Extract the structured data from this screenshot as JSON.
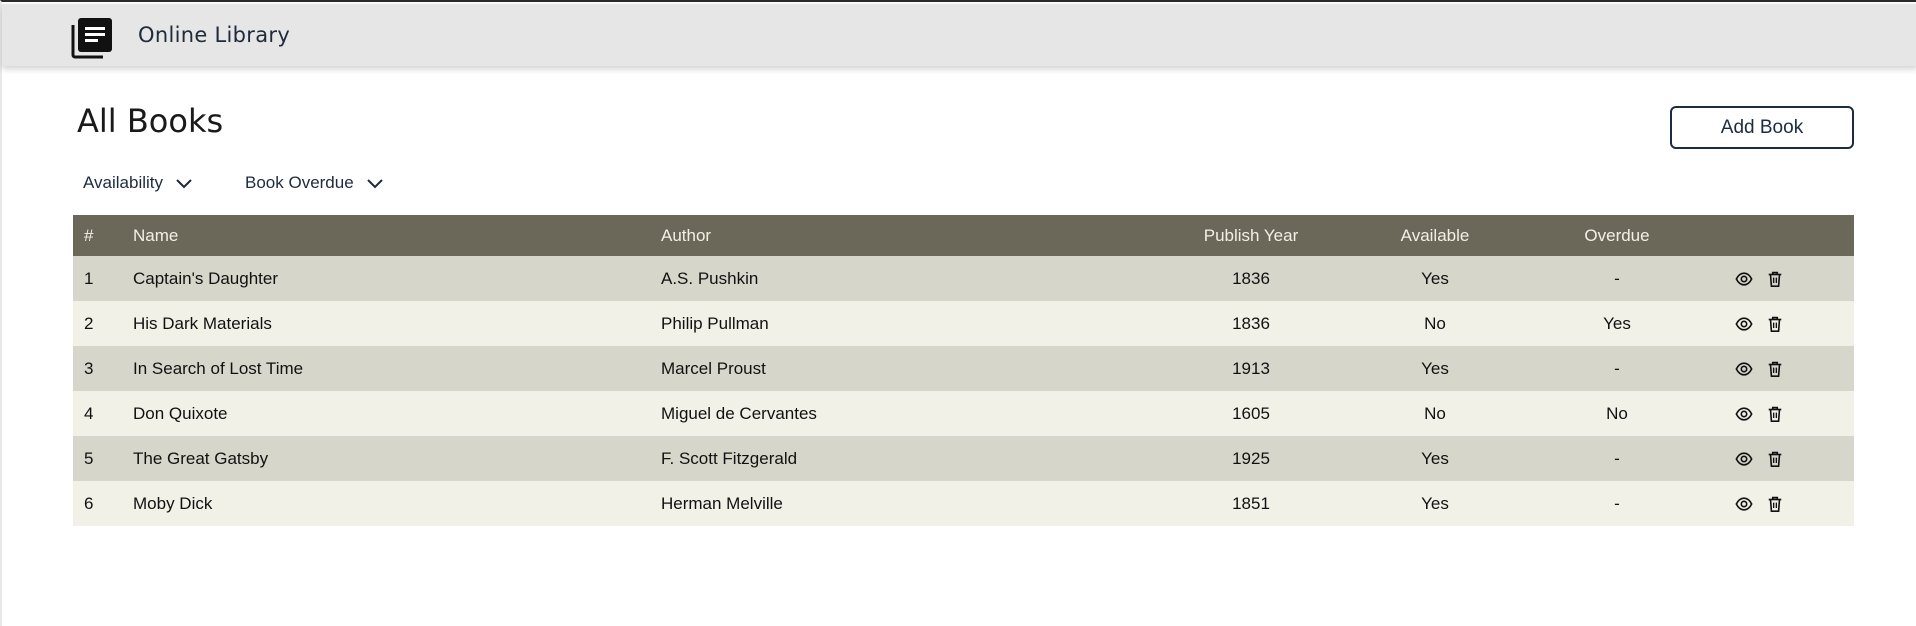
{
  "app": {
    "title": "Online Library",
    "logo_icon": "book-icon"
  },
  "page": {
    "title": "All Books"
  },
  "toolbar": {
    "add_label": "Add Book"
  },
  "filters": [
    {
      "label": "Availability",
      "icon": "chevron-down-icon"
    },
    {
      "label": "Book Overdue",
      "icon": "chevron-down-icon"
    }
  ],
  "table": {
    "columns": [
      "#",
      "Name",
      "Author",
      "Publish Year",
      "Available",
      "Overdue",
      ""
    ],
    "rows": [
      {
        "num": "1",
        "name": "Captain's Daughter",
        "author": "A.S. Pushkin",
        "year": "1836",
        "available": "Yes",
        "overdue": "-"
      },
      {
        "num": "2",
        "name": "His Dark Materials",
        "author": "Philip Pullman",
        "year": "1836",
        "available": "No",
        "overdue": "Yes"
      },
      {
        "num": "3",
        "name": "In Search of Lost Time",
        "author": "Marcel Proust",
        "year": "1913",
        "available": "Yes",
        "overdue": "-"
      },
      {
        "num": "4",
        "name": "Don Quixote",
        "author": "Miguel de Cervantes",
        "year": "1605",
        "available": "No",
        "overdue": "No"
      },
      {
        "num": "5",
        "name": "The Great Gatsby",
        "author": "F. Scott Fitzgerald",
        "year": "1925",
        "available": "Yes",
        "overdue": "-"
      },
      {
        "num": "6",
        "name": "Moby Dick",
        "author": "Herman Melville",
        "year": "1851",
        "available": "Yes",
        "overdue": "-"
      }
    ],
    "row_actions": [
      "eye-icon",
      "trash-icon"
    ]
  },
  "colors": {
    "topbar_bg": "#e6e6e6",
    "header_bg": "#6b6859",
    "row_odd_bg": "#d7d6cb",
    "row_even_bg": "#f1f1e8",
    "accent": "#1d2b40"
  }
}
